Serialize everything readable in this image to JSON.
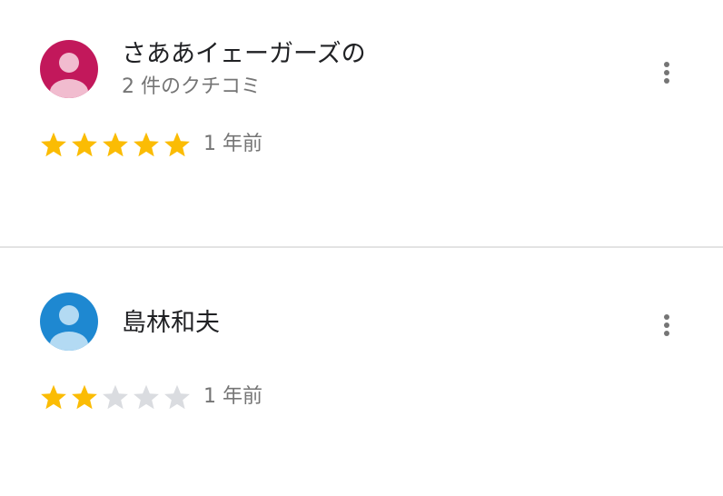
{
  "colors": {
    "star_filled": "#fbbc04",
    "star_empty": "#dadce0",
    "secondary_text": "#757575",
    "divider": "#e3e3e3",
    "more_icon": "#757575"
  },
  "reviews": [
    {
      "name": "さああイェーガーズの",
      "review_count": "2 件のクチコミ",
      "rating": 5,
      "max_rating": 5,
      "time": "1 年前",
      "avatar_icon": "person-icon",
      "avatar_bg": "#c2185b",
      "avatar_fg": "#f1bccf"
    },
    {
      "name": "島林和夫",
      "review_count": "",
      "rating": 2,
      "max_rating": 5,
      "time": "1 年前",
      "avatar_icon": "person-icon",
      "avatar_bg": "#1e88d1",
      "avatar_fg": "#b3daf3"
    }
  ]
}
